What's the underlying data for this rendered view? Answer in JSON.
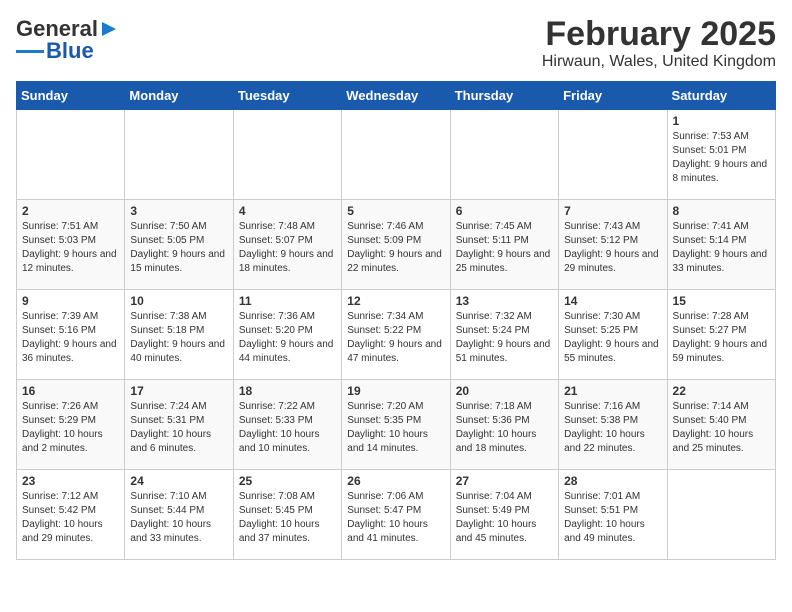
{
  "header": {
    "logo_general": "General",
    "logo_blue": "Blue",
    "title": "February 2025",
    "subtitle": "Hirwaun, Wales, United Kingdom"
  },
  "columns": [
    "Sunday",
    "Monday",
    "Tuesday",
    "Wednesday",
    "Thursday",
    "Friday",
    "Saturday"
  ],
  "weeks": [
    [
      {
        "day": "",
        "info": ""
      },
      {
        "day": "",
        "info": ""
      },
      {
        "day": "",
        "info": ""
      },
      {
        "day": "",
        "info": ""
      },
      {
        "day": "",
        "info": ""
      },
      {
        "day": "",
        "info": ""
      },
      {
        "day": "1",
        "info": "Sunrise: 7:53 AM\nSunset: 5:01 PM\nDaylight: 9 hours and 8 minutes."
      }
    ],
    [
      {
        "day": "2",
        "info": "Sunrise: 7:51 AM\nSunset: 5:03 PM\nDaylight: 9 hours and 12 minutes."
      },
      {
        "day": "3",
        "info": "Sunrise: 7:50 AM\nSunset: 5:05 PM\nDaylight: 9 hours and 15 minutes."
      },
      {
        "day": "4",
        "info": "Sunrise: 7:48 AM\nSunset: 5:07 PM\nDaylight: 9 hours and 18 minutes."
      },
      {
        "day": "5",
        "info": "Sunrise: 7:46 AM\nSunset: 5:09 PM\nDaylight: 9 hours and 22 minutes."
      },
      {
        "day": "6",
        "info": "Sunrise: 7:45 AM\nSunset: 5:11 PM\nDaylight: 9 hours and 25 minutes."
      },
      {
        "day": "7",
        "info": "Sunrise: 7:43 AM\nSunset: 5:12 PM\nDaylight: 9 hours and 29 minutes."
      },
      {
        "day": "8",
        "info": "Sunrise: 7:41 AM\nSunset: 5:14 PM\nDaylight: 9 hours and 33 minutes."
      }
    ],
    [
      {
        "day": "9",
        "info": "Sunrise: 7:39 AM\nSunset: 5:16 PM\nDaylight: 9 hours and 36 minutes."
      },
      {
        "day": "10",
        "info": "Sunrise: 7:38 AM\nSunset: 5:18 PM\nDaylight: 9 hours and 40 minutes."
      },
      {
        "day": "11",
        "info": "Sunrise: 7:36 AM\nSunset: 5:20 PM\nDaylight: 9 hours and 44 minutes."
      },
      {
        "day": "12",
        "info": "Sunrise: 7:34 AM\nSunset: 5:22 PM\nDaylight: 9 hours and 47 minutes."
      },
      {
        "day": "13",
        "info": "Sunrise: 7:32 AM\nSunset: 5:24 PM\nDaylight: 9 hours and 51 minutes."
      },
      {
        "day": "14",
        "info": "Sunrise: 7:30 AM\nSunset: 5:25 PM\nDaylight: 9 hours and 55 minutes."
      },
      {
        "day": "15",
        "info": "Sunrise: 7:28 AM\nSunset: 5:27 PM\nDaylight: 9 hours and 59 minutes."
      }
    ],
    [
      {
        "day": "16",
        "info": "Sunrise: 7:26 AM\nSunset: 5:29 PM\nDaylight: 10 hours and 2 minutes."
      },
      {
        "day": "17",
        "info": "Sunrise: 7:24 AM\nSunset: 5:31 PM\nDaylight: 10 hours and 6 minutes."
      },
      {
        "day": "18",
        "info": "Sunrise: 7:22 AM\nSunset: 5:33 PM\nDaylight: 10 hours and 10 minutes."
      },
      {
        "day": "19",
        "info": "Sunrise: 7:20 AM\nSunset: 5:35 PM\nDaylight: 10 hours and 14 minutes."
      },
      {
        "day": "20",
        "info": "Sunrise: 7:18 AM\nSunset: 5:36 PM\nDaylight: 10 hours and 18 minutes."
      },
      {
        "day": "21",
        "info": "Sunrise: 7:16 AM\nSunset: 5:38 PM\nDaylight: 10 hours and 22 minutes."
      },
      {
        "day": "22",
        "info": "Sunrise: 7:14 AM\nSunset: 5:40 PM\nDaylight: 10 hours and 25 minutes."
      }
    ],
    [
      {
        "day": "23",
        "info": "Sunrise: 7:12 AM\nSunset: 5:42 PM\nDaylight: 10 hours and 29 minutes."
      },
      {
        "day": "24",
        "info": "Sunrise: 7:10 AM\nSunset: 5:44 PM\nDaylight: 10 hours and 33 minutes."
      },
      {
        "day": "25",
        "info": "Sunrise: 7:08 AM\nSunset: 5:45 PM\nDaylight: 10 hours and 37 minutes."
      },
      {
        "day": "26",
        "info": "Sunrise: 7:06 AM\nSunset: 5:47 PM\nDaylight: 10 hours and 41 minutes."
      },
      {
        "day": "27",
        "info": "Sunrise: 7:04 AM\nSunset: 5:49 PM\nDaylight: 10 hours and 45 minutes."
      },
      {
        "day": "28",
        "info": "Sunrise: 7:01 AM\nSunset: 5:51 PM\nDaylight: 10 hours and 49 minutes."
      },
      {
        "day": "",
        "info": ""
      }
    ]
  ]
}
